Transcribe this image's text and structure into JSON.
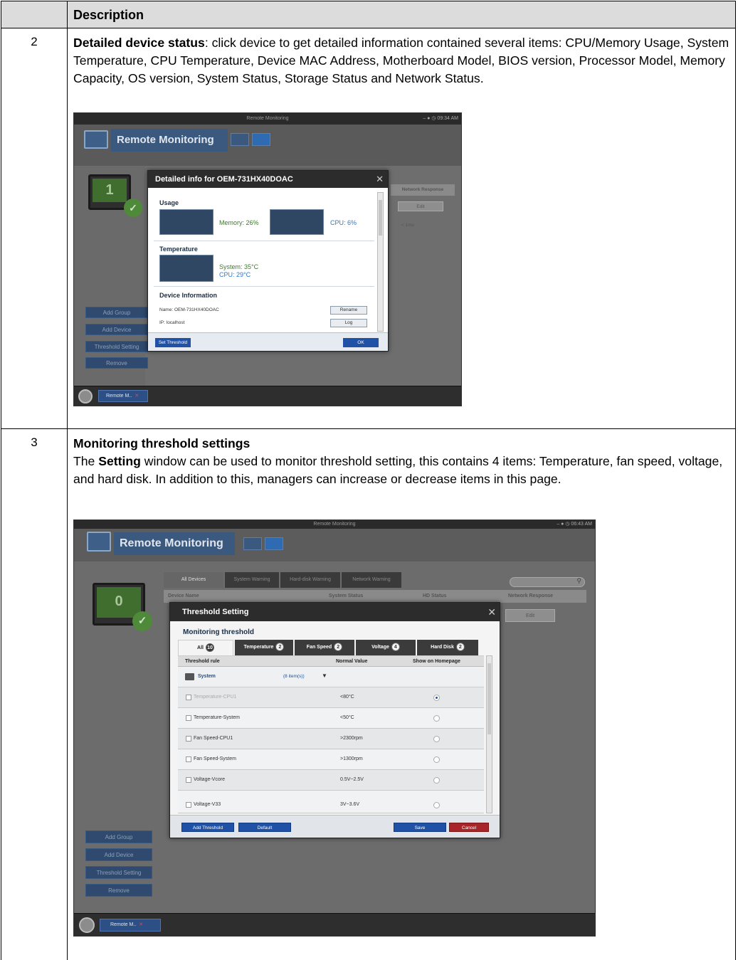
{
  "table": {
    "header_description": "Description"
  },
  "row2": {
    "number": "2",
    "title": "Detailed device status",
    "text": ": click device to get detailed information contained several items: CPU/Memory Usage, System Temperature, CPU Temperature, Device MAC Address, Motherboard Model, BIOS version, Processor Model, Memory Capacity, OS version, System Status, Storage Status and Network Status."
  },
  "row3": {
    "number": "3",
    "title": "Monitoring threshold settings",
    "text_before": "The ",
    "text_bold": "Setting",
    "text_after": " window can be used to monitor threshold setting, this contains 4 items: Temperature, fan speed, voltage, and hard disk. In addition to this, managers can increase or decrease items in this page."
  },
  "shot1": {
    "window_title": "Remote Monitoring",
    "clock": "09:34 AM",
    "app_title": "Remote Monitoring",
    "device_count": "1",
    "col_network_response": "Network Response",
    "edit_label": "Edit",
    "latency": "< 1ms",
    "side_buttons": [
      "Add Group",
      "Add Device",
      "Threshold Setting",
      "Remove"
    ],
    "taskbar_label": "Remote M..",
    "modal": {
      "title": "Detailed info for OEM-731HX40DOAC",
      "usage_title": "Usage",
      "memory": "Memory: 26%",
      "cpu": "CPU: 6%",
      "temperature_title": "Temperature",
      "system_temp": "System: 35°C",
      "cpu_temp": "CPU: 29°C",
      "device_info_title": "Device Information",
      "name": "Name: OEM-731HX40DOAC",
      "ip": "IP: localhost",
      "rename": "Rename",
      "log": "Log",
      "set_threshold": "Set Threshold",
      "ok": "OK"
    }
  },
  "shot2": {
    "window_title": "Remote Monitoring",
    "clock": "06:43 AM",
    "app_title": "Remote Monitoring",
    "device_count": "0",
    "tabs": [
      "All Devices",
      "System Warning",
      "Hard-disk Warning",
      "Network Warning"
    ],
    "columns": [
      "Device Name",
      "System Status",
      "HD Status",
      "Network Response"
    ],
    "edit_label": "Edit",
    "side_buttons": [
      "Add Group",
      "Add Device",
      "Threshold Setting",
      "Remove"
    ],
    "taskbar_label": "Remote M..",
    "modal": {
      "title": "Threshold Setting",
      "subtitle": "Monitoring threshold",
      "tabs": [
        {
          "label": "All",
          "count": "10"
        },
        {
          "label": "Temperature",
          "count": "2"
        },
        {
          "label": "Fan Speed",
          "count": "2"
        },
        {
          "label": "Voltage",
          "count": "4"
        },
        {
          "label": "Hard Disk",
          "count": "2"
        }
      ],
      "col_rule": "Threshold rule",
      "col_normal": "Normal Value",
      "col_show": "Show on Homepage",
      "group_name": "System",
      "group_count": "(8 item(s))",
      "rows": [
        {
          "rule": "Temperature-CPU1",
          "normal": "<80°C"
        },
        {
          "rule": "Temperature-System",
          "normal": "<50°C"
        },
        {
          "rule": "Fan Speed-CPU1",
          "normal": ">2300rpm"
        },
        {
          "rule": "Fan Speed-System",
          "normal": ">1300rpm"
        },
        {
          "rule": "Voltage-Vcore",
          "normal": "0.5V~2.5V"
        },
        {
          "rule": "Voltage-V33",
          "normal": "3V~3.6V"
        }
      ],
      "add_threshold": "Add Threshold",
      "default": "Default",
      "save": "Save",
      "cancel": "Cancel"
    }
  }
}
